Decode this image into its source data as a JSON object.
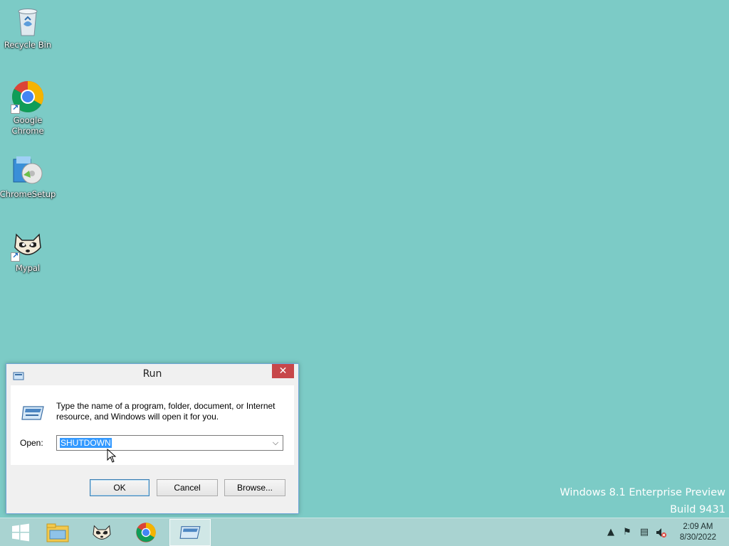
{
  "desktop": {
    "icons": [
      {
        "label": "Recycle Bin"
      },
      {
        "label": "Google Chrome"
      },
      {
        "label": "ChromeSetup"
      },
      {
        "label": "Mypal"
      }
    ],
    "watermark": {
      "line1": "Windows 8.1 Enterprise Preview",
      "line2": "Build 9431"
    }
  },
  "run_dialog": {
    "title": "Run",
    "close_glyph": "✕",
    "description": "Type the name of a program, folder, document, or Internet resource, and Windows will open it for you.",
    "open_label": "Open:",
    "open_value": "SHUTDOWN",
    "buttons": {
      "ok": "OK",
      "cancel": "Cancel",
      "browse": "Browse..."
    }
  },
  "taskbar": {
    "pinned": [
      {
        "icon": "windows-start-icon"
      },
      {
        "icon": "file-explorer-icon"
      },
      {
        "icon": "mypal-icon"
      },
      {
        "icon": "chrome-icon"
      },
      {
        "icon": "run-icon",
        "active": true
      }
    ],
    "tray": {
      "time": "2:09 AM",
      "date": "8/30/2022"
    }
  },
  "colors": {
    "desktop_bg": "#7ccbc6",
    "taskbar_bg": "#a9d3d1",
    "close_button": "#c7474a",
    "selection": "#3399ff"
  }
}
